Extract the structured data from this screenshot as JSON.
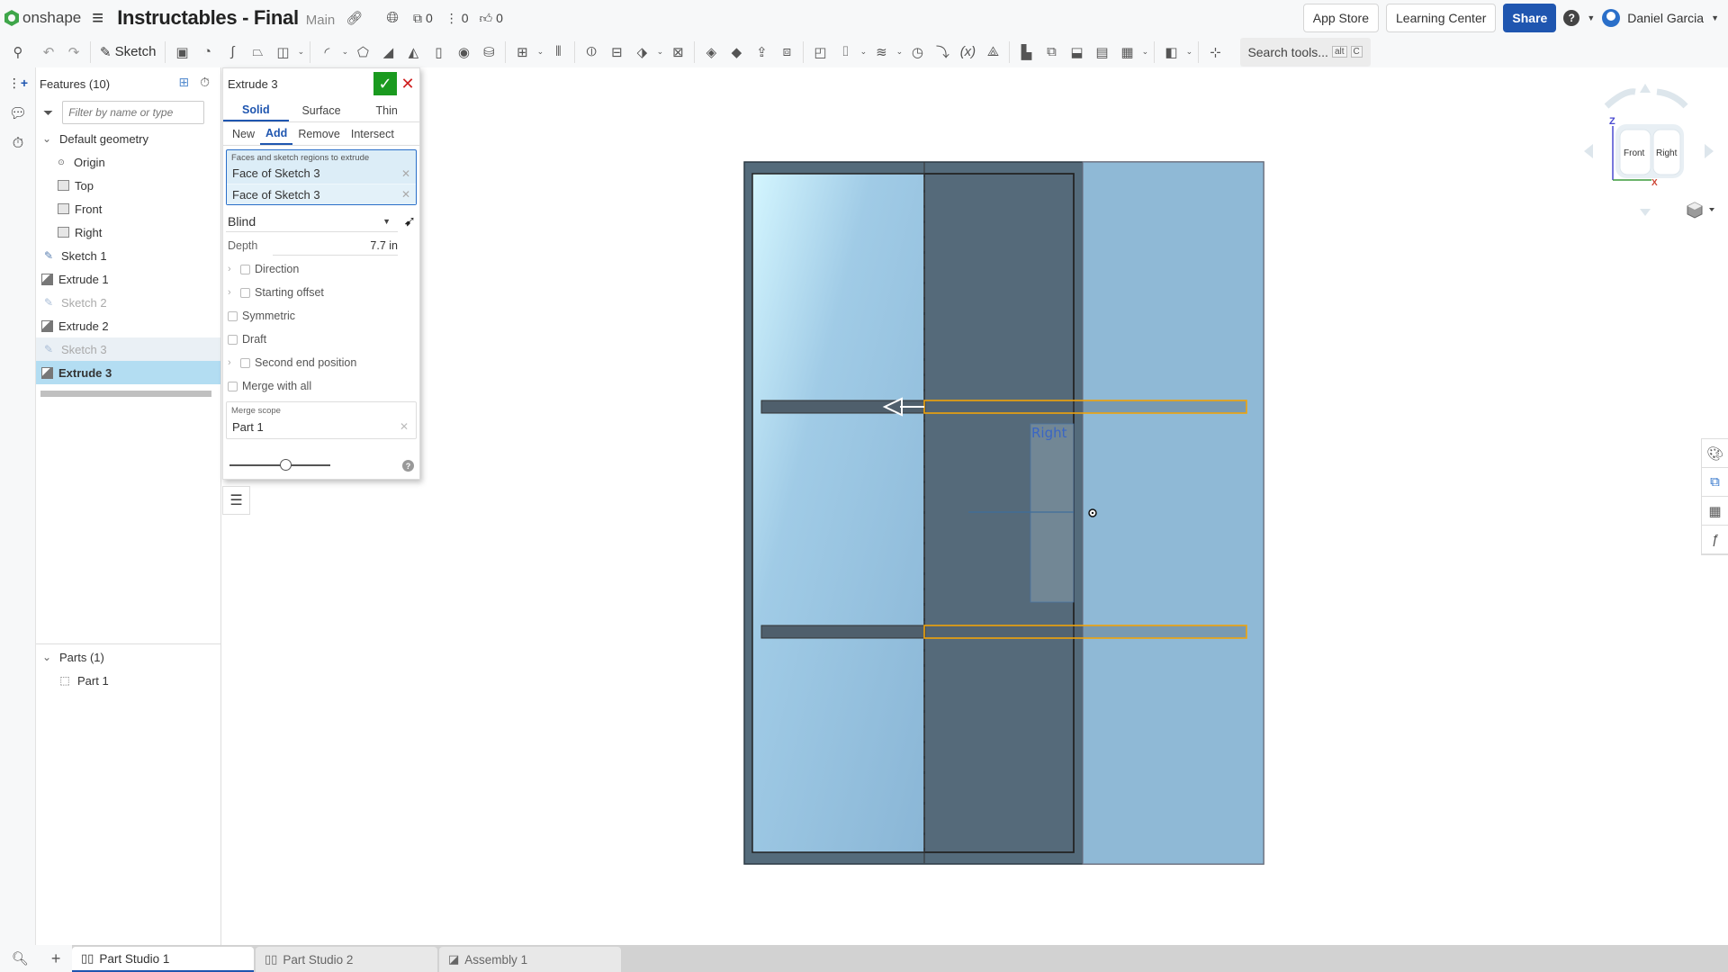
{
  "topbar": {
    "logo_text": "onshape",
    "document_title": "Instructables - Final",
    "branch": "Main",
    "versions_count": "0",
    "branches_count": "0",
    "likes_count": "0",
    "app_store": "App Store",
    "learning_center": "Learning Center",
    "share": "Share",
    "user_name": "Daniel Garcia"
  },
  "toolbar": {
    "sketch_label": "Sketch",
    "search_placeholder": "Search tools...",
    "search_shortcut_1": "alt",
    "search_shortcut_2": "C"
  },
  "features": {
    "header": "Features (10)",
    "filter_placeholder": "Filter by name or type",
    "default_geometry": "Default geometry",
    "items": [
      {
        "label": "Origin",
        "type": "origin"
      },
      {
        "label": "Top",
        "type": "plane"
      },
      {
        "label": "Front",
        "type": "plane"
      },
      {
        "label": "Right",
        "type": "plane"
      },
      {
        "label": "Sketch 1",
        "type": "sketch"
      },
      {
        "label": "Extrude 1",
        "type": "extrude"
      },
      {
        "label": "Sketch 2",
        "type": "sketch",
        "state": "hidden"
      },
      {
        "label": "Extrude 2",
        "type": "extrude"
      },
      {
        "label": "Sketch 3",
        "type": "sketch",
        "state": "hidden-highlighted"
      },
      {
        "label": "Extrude 3",
        "type": "extrude",
        "state": "selected"
      }
    ],
    "parts_header": "Parts (1)",
    "parts": [
      {
        "label": "Part 1"
      }
    ]
  },
  "dialog": {
    "title": "Extrude 3",
    "tabs": [
      "Solid",
      "Surface",
      "Thin"
    ],
    "active_tab": "Solid",
    "operations": [
      "New",
      "Add",
      "Remove",
      "Intersect"
    ],
    "active_operation": "Add",
    "selection_label": "Faces and sketch regions to extrude",
    "selections": [
      "Face of Sketch 3",
      "Face of Sketch 3"
    ],
    "end_type": "Blind",
    "depth_label": "Depth",
    "depth_value": "7.7 in",
    "options": {
      "direction": "Direction",
      "starting_offset": "Starting offset",
      "symmetric": "Symmetric",
      "draft": "Draft",
      "second_end": "Second end position",
      "merge_all": "Merge with all"
    },
    "merge_scope_label": "Merge scope",
    "merge_scope_value": "Part 1",
    "detail_slider": 0.55
  },
  "viewport": {
    "plane_label": "Right",
    "view_cube": {
      "front": "Front",
      "right": "Right",
      "z_axis": "Z",
      "x_axis": "X"
    },
    "colors": {
      "part_light": "#8fb9d6",
      "part_dark": "#546b7b",
      "selection": "#f0a30a",
      "plane_label": "#3a66c4"
    }
  },
  "bottom_tabs": [
    {
      "label": "Part Studio 1",
      "active": true
    },
    {
      "label": "Part Studio 2",
      "active": false
    },
    {
      "label": "Assembly 1",
      "active": false
    }
  ]
}
